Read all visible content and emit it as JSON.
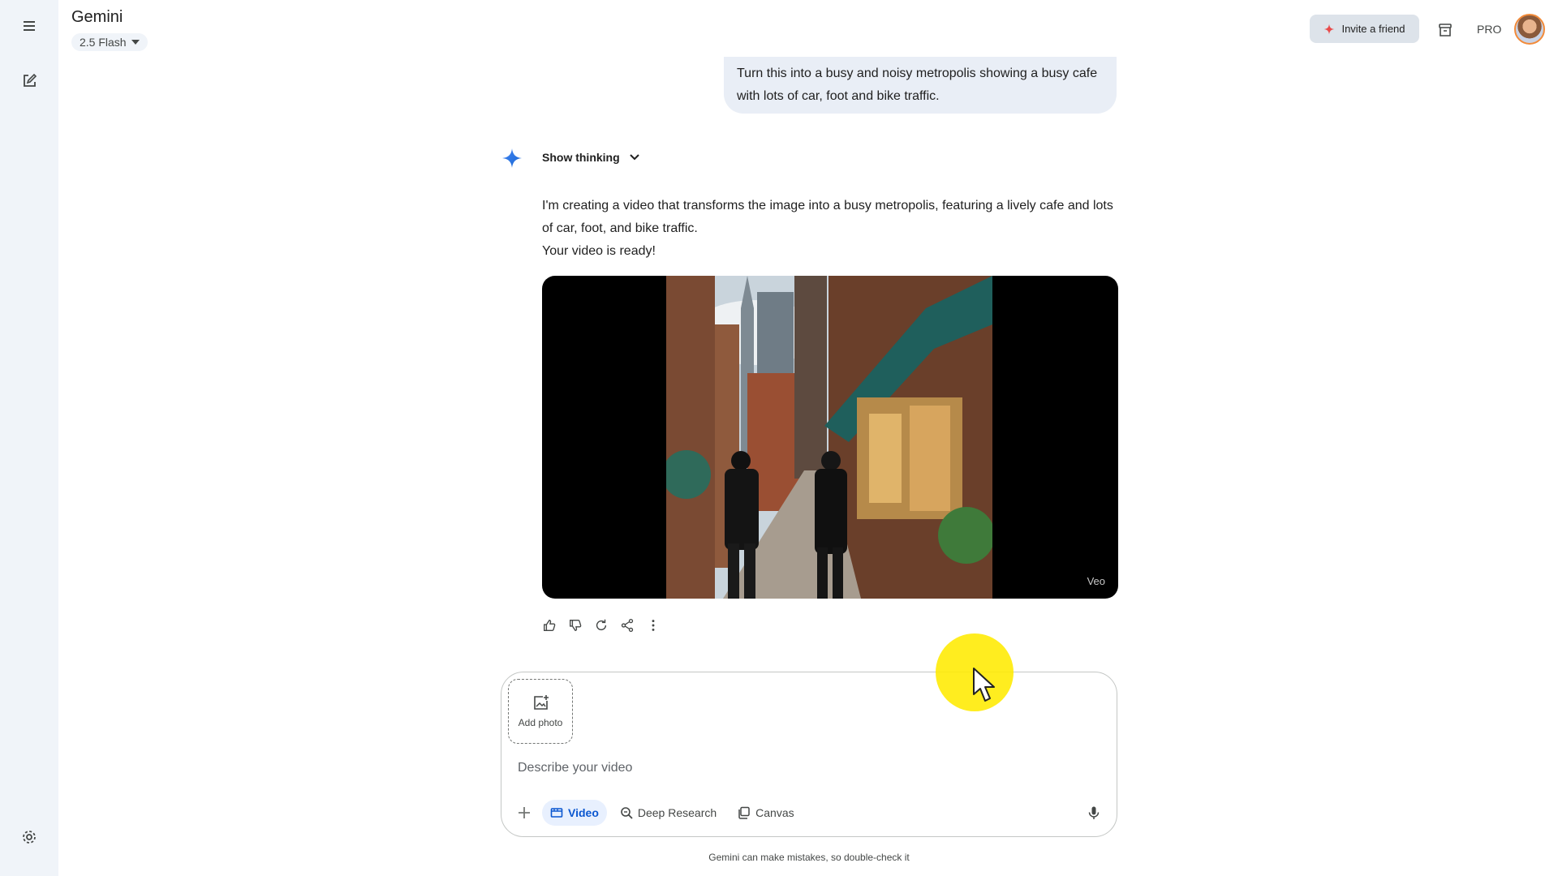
{
  "app": {
    "title": "Gemini",
    "model": "2.5 Flash"
  },
  "header": {
    "invite_label": "Invite a friend",
    "tier_badge": "PRO"
  },
  "rail": {
    "icons": [
      "menu-icon",
      "new-chat-icon",
      "settings-icon"
    ]
  },
  "conversation": {
    "user_message": "Turn this into a busy and noisy metropolis showing a busy cafe with lots of car, foot and bike traffic.",
    "thinking_toggle": "Show thinking",
    "response_lines": [
      "I'm creating a video that transforms the image into a busy metropolis, featuring a lively cafe and lots of car, foot, and bike traffic.",
      "Your video is ready!"
    ],
    "video_watermark": "Veo",
    "actions": [
      "thumbs-up-icon",
      "thumbs-down-icon",
      "regenerate-icon",
      "share-icon",
      "more-vert-icon"
    ]
  },
  "composer": {
    "add_photo_label": "Add photo",
    "placeholder": "Describe your video",
    "tools": [
      {
        "label": "Video",
        "active": true,
        "icon": "video-icon"
      },
      {
        "label": "Deep Research",
        "active": false,
        "icon": "deep-research-icon"
      },
      {
        "label": "Canvas",
        "active": false,
        "icon": "canvas-icon"
      }
    ]
  },
  "footer": {
    "disclaimer": "Gemini can make mistakes, so double-check it"
  },
  "colors": {
    "accent": "#0b57d0",
    "rail_bg": "#f0f4f9",
    "user_bubble": "#e9eef6",
    "invite_bg": "#dde3ea",
    "cursor_highlight": "#ffeb00"
  }
}
